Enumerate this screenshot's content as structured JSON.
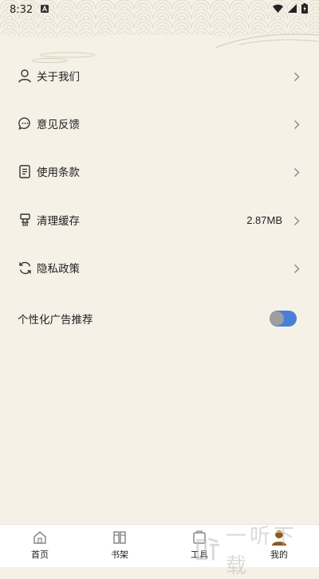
{
  "status_bar": {
    "time": "8:32",
    "icons": [
      "notification-a-icon",
      "wifi-icon",
      "signal-icon",
      "battery-icon"
    ]
  },
  "menu": {
    "items": [
      {
        "label": "关于我们",
        "icon": "person-icon",
        "value": ""
      },
      {
        "label": "意见反馈",
        "icon": "chat-bubble-icon",
        "value": ""
      },
      {
        "label": "使用条款",
        "icon": "document-icon",
        "value": ""
      },
      {
        "label": "清理缓存",
        "icon": "broom-icon",
        "value": "2.87MB"
      },
      {
        "label": "隐私政策",
        "icon": "refresh-icon",
        "value": ""
      }
    ],
    "ad_toggle": {
      "label": "个性化广告推荐",
      "enabled": true
    }
  },
  "tabbar": {
    "tabs": [
      {
        "label": "首页",
        "icon": "home-icon",
        "active": false
      },
      {
        "label": "书架",
        "icon": "bookshelf-icon",
        "active": false
      },
      {
        "label": "工具",
        "icon": "tools-icon",
        "active": false
      },
      {
        "label": "我的",
        "icon": "profile-icon",
        "active": true
      }
    ]
  },
  "colors": {
    "background": "#f5f1e7",
    "toggle_on": "#4a7fd6",
    "accent_brown": "#8b5a1f"
  }
}
